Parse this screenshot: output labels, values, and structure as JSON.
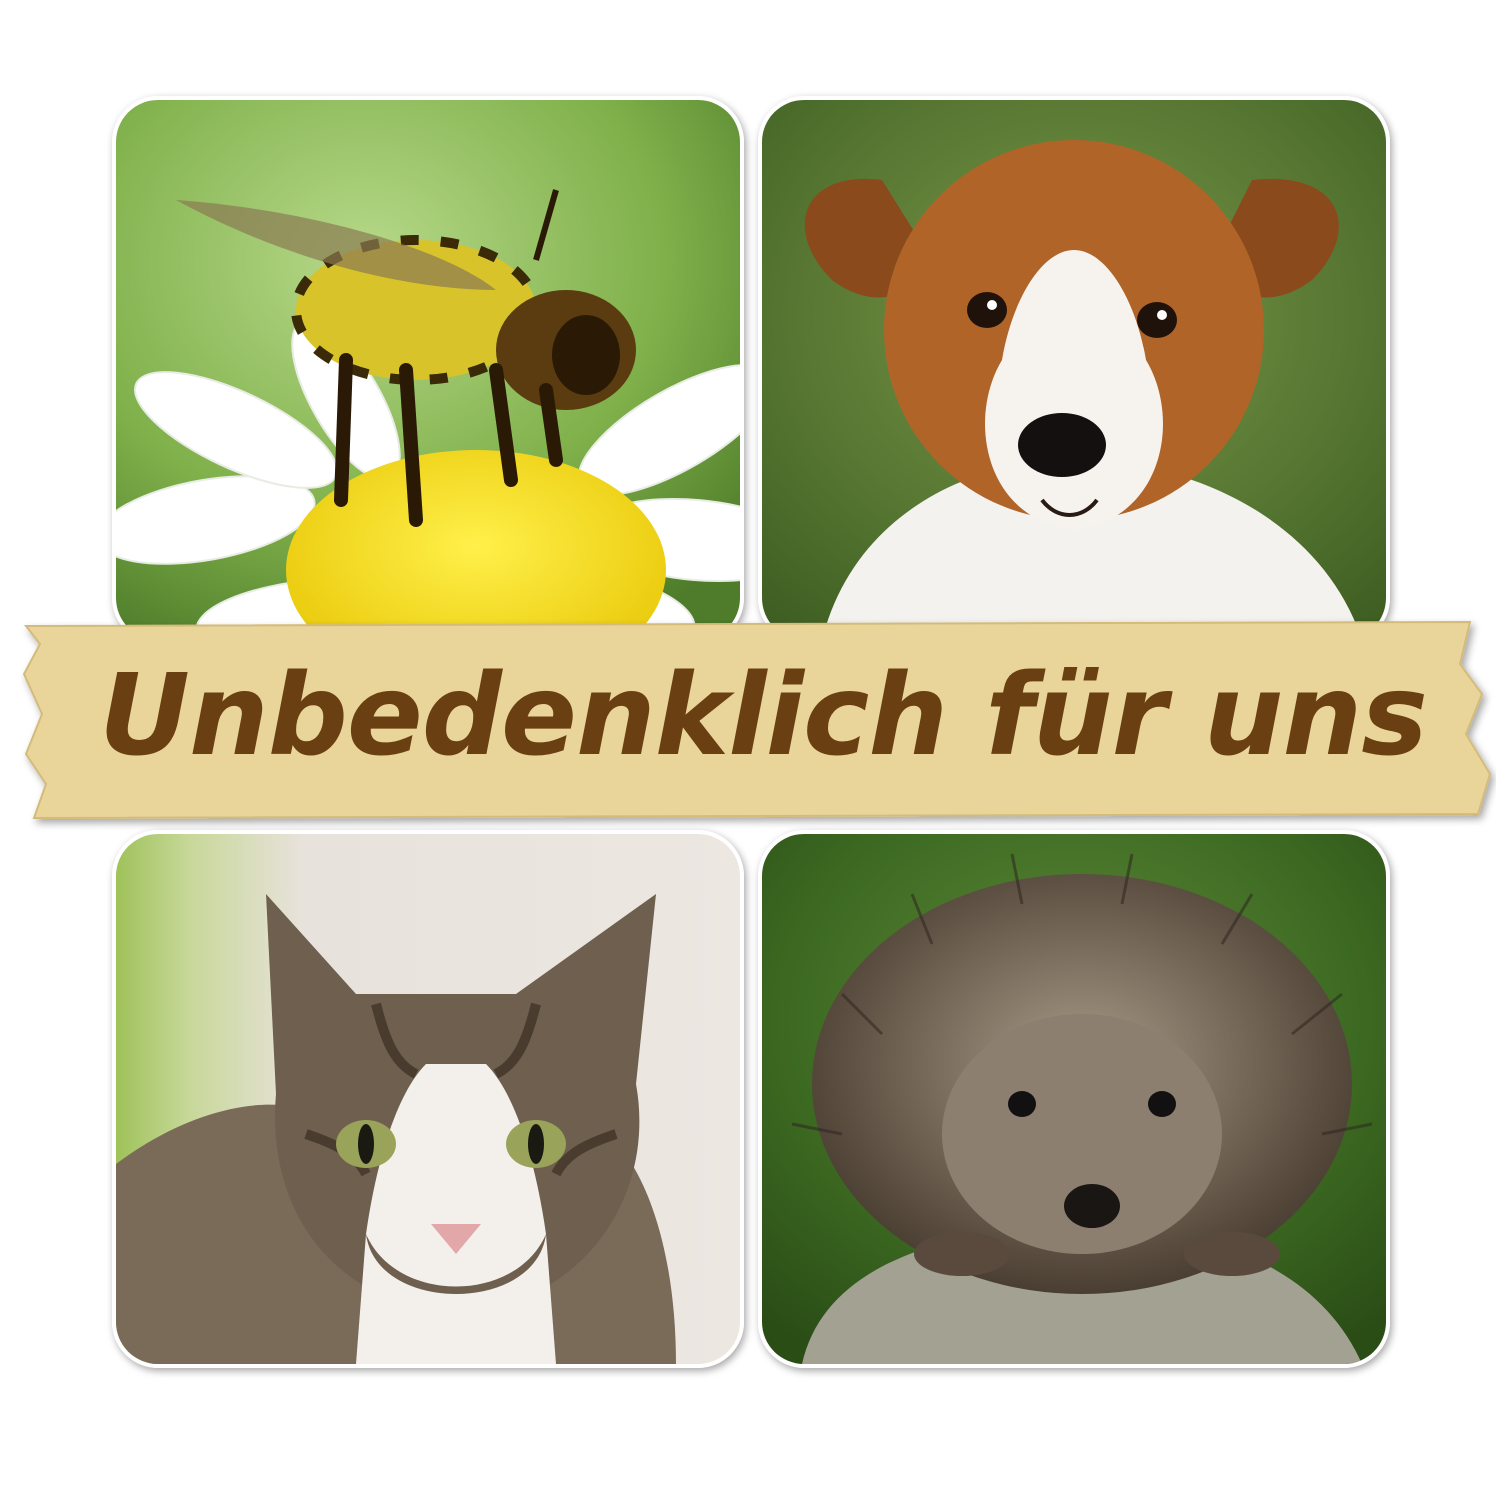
{
  "banner": {
    "text": "Unbedenklich für uns",
    "text_color": "#6a3f12",
    "background_color": "#e9d49a"
  },
  "tiles": [
    {
      "subject": "bee on daisy"
    },
    {
      "subject": "terrier puppy"
    },
    {
      "subject": "tabby and white cat"
    },
    {
      "subject": "hedgehog on rock"
    }
  ]
}
